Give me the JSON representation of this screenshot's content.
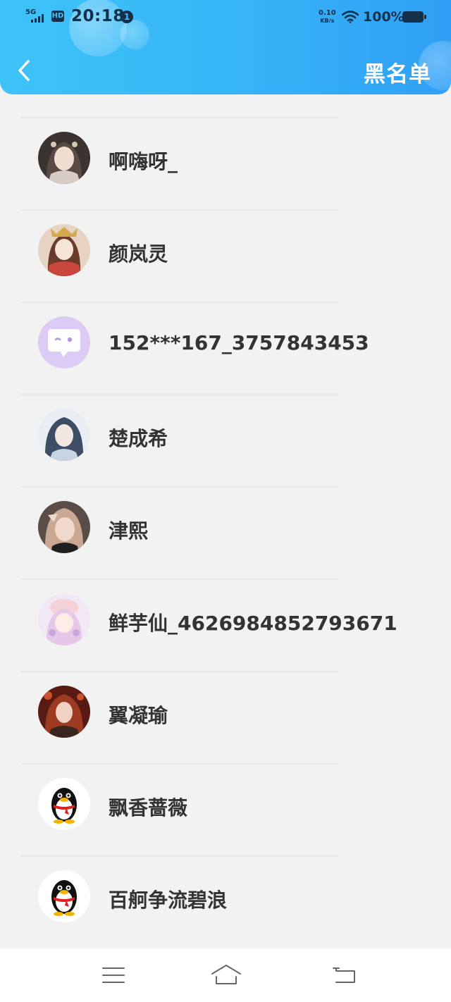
{
  "status_bar": {
    "network": "5G",
    "hd": "HD",
    "time": "20:18",
    "notification_count": "1",
    "net_speed_value": "0.10",
    "net_speed_unit": "KB/s",
    "battery": "100%"
  },
  "header": {
    "title": "黑名单",
    "back_icon": "chevron-left-icon"
  },
  "blacklist": [
    {
      "name": "啊嗨呀_",
      "avatar": "anime-girl-avatar"
    },
    {
      "name": "颜岚灵",
      "avatar": "anime-girl-avatar"
    },
    {
      "name": "152***167_3757843453",
      "avatar": "default-chat-avatar"
    },
    {
      "name": "楚成希",
      "avatar": "anime-boy-avatar"
    },
    {
      "name": "津熙",
      "avatar": "photo-avatar"
    },
    {
      "name": "鲜芋仙_4626984852793671",
      "avatar": "anime-girl-avatar"
    },
    {
      "name": "翼凝瑜",
      "avatar": "anime-girl-avatar"
    },
    {
      "name": "飘香蔷薇",
      "avatar": "qq-penguin-avatar"
    },
    {
      "name": "百舸争流碧浪",
      "avatar": "qq-penguin-avatar"
    }
  ],
  "nav_bar": {
    "menu_icon": "menu-icon",
    "home_icon": "home-icon",
    "back_icon": "back-icon"
  },
  "colors": {
    "header_gradient_start": "#3ec3f7",
    "header_gradient_end": "#2f9ff5",
    "background": "#f2f2f2",
    "name_text": "#333333"
  }
}
